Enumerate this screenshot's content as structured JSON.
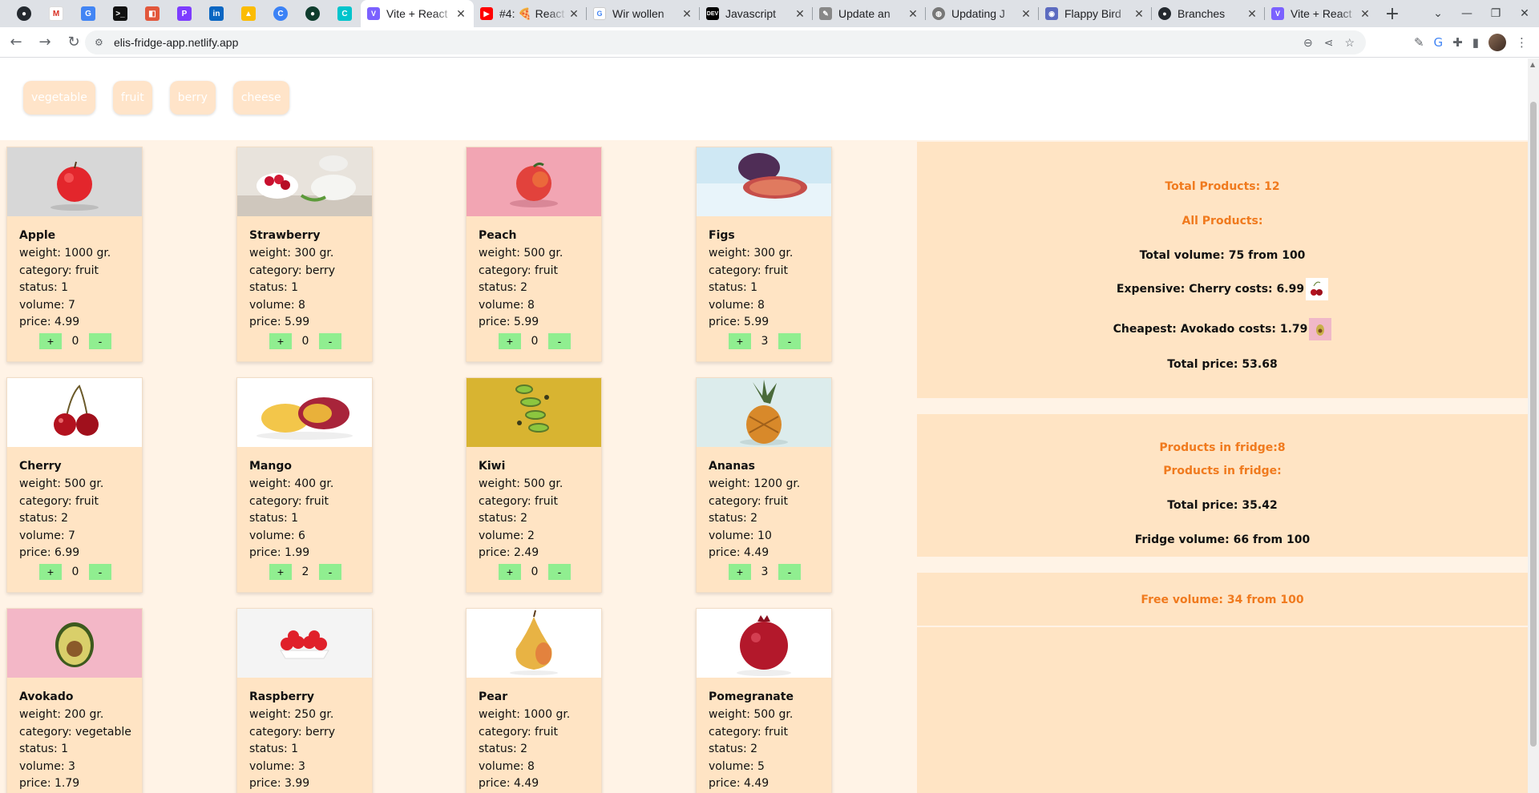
{
  "browser": {
    "tabs": [
      {
        "title": "Vite + React",
        "active": true,
        "color": "#7b61ff"
      },
      {
        "title": "#4: 🍕 React",
        "active": false,
        "color": "#ff0000"
      },
      {
        "title": "Wir wollen",
        "active": false,
        "color": "#4285f4"
      },
      {
        "title": "Javascript",
        "active": false,
        "color": "#000000"
      },
      {
        "title": "Update an",
        "active": false,
        "color": "#666666"
      },
      {
        "title": "Updating J",
        "active": false,
        "color": "#555555"
      },
      {
        "title": "Flappy Bird",
        "active": false,
        "color": "#5c6bc0"
      },
      {
        "title": "Branches",
        "active": false,
        "color": "#24292f"
      },
      {
        "title": "Vite + React",
        "active": false,
        "color": "#7b61ff"
      }
    ],
    "url": "elis-fridge-app.netlify.app"
  },
  "filters": [
    "vegetable",
    "fruit",
    "berry",
    "cheese"
  ],
  "products": [
    {
      "name": "Apple",
      "weight": "weight: 1000 gr.",
      "category": "category: fruit",
      "status": "status: 1",
      "volume": "volume: 7",
      "price": "price: 4.99",
      "count": "0"
    },
    {
      "name": "Strawberry",
      "weight": "weight: 300 gr.",
      "category": "category: berry",
      "status": "status: 1",
      "volume": "volume: 8",
      "price": "price: 5.99",
      "count": "0"
    },
    {
      "name": "Peach",
      "weight": "weight: 500 gr.",
      "category": "category: fruit",
      "status": "status: 2",
      "volume": "volume: 8",
      "price": "price: 5.99",
      "count": "0"
    },
    {
      "name": "Figs",
      "weight": "weight: 300 gr.",
      "category": "category: fruit",
      "status": "status: 1",
      "volume": "volume: 8",
      "price": "price: 5.99",
      "count": "3"
    },
    {
      "name": "Cherry",
      "weight": "weight: 500 gr.",
      "category": "category: fruit",
      "status": "status: 2",
      "volume": "volume: 7",
      "price": "price: 6.99",
      "count": "0"
    },
    {
      "name": "Mango",
      "weight": "weight: 400 gr.",
      "category": "category: fruit",
      "status": "status: 1",
      "volume": "volume: 6",
      "price": "price: 1.99",
      "count": "2"
    },
    {
      "name": "Kiwi",
      "weight": "weight: 500 gr.",
      "category": "category: fruit",
      "status": "status: 2",
      "volume": "volume: 2",
      "price": "price: 2.49",
      "count": "0"
    },
    {
      "name": "Ananas",
      "weight": "weight: 1200 gr.",
      "category": "category: fruit",
      "status": "status: 2",
      "volume": "volume: 10",
      "price": "price: 4.49",
      "count": "3"
    },
    {
      "name": "Avokado",
      "weight": "weight: 200 gr.",
      "category": "category: vegetable",
      "status": "status: 1",
      "volume": "volume: 3",
      "price": "price: 1.79",
      "count": ""
    },
    {
      "name": "Raspberry",
      "weight": "weight: 250 gr.",
      "category": "category: berry",
      "status": "status: 1",
      "volume": "volume: 3",
      "price": "price: 3.99",
      "count": ""
    },
    {
      "name": "Pear",
      "weight": "weight: 1000 gr.",
      "category": "category: fruit",
      "status": "status: 2",
      "volume": "volume: 8",
      "price": "price: 4.49",
      "count": ""
    },
    {
      "name": "Pomegranate",
      "weight": "weight: 500 gr.",
      "category": "category: fruit",
      "status": "status: 2",
      "volume": "volume: 5",
      "price": "price: 4.49",
      "count": ""
    }
  ],
  "buttons": {
    "plus": "+",
    "minus": "-"
  },
  "summary": {
    "total_products": "Total Products: 12",
    "all_products": "All Products:",
    "total_volume": "Total volume: 75 from 100",
    "expensive": "Expensive: Cherry costs: 6.99",
    "cheapest": "Cheapest: Avokado costs: 1.79",
    "total_price": "Total price: 53.68"
  },
  "fridge": {
    "count": "Products in fridge:8",
    "label": "Products in fridge:",
    "total_price": "Total price: 35.42",
    "volume": "Fridge volume: 66 from 100"
  },
  "free": {
    "volume": "Free volume: 34 from 100"
  },
  "colors": {
    "accent_orange": "#f07a1e",
    "card_bg": "#ffe4c4",
    "button_green": "#90ee90"
  }
}
